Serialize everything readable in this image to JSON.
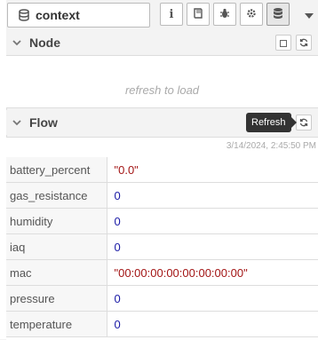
{
  "sidebar_tab": {
    "label": "context"
  },
  "toolbar": {
    "buttons": [
      {
        "icon": "info-icon"
      },
      {
        "icon": "book-icon"
      },
      {
        "icon": "bug-icon"
      },
      {
        "icon": "gear-icon"
      },
      {
        "icon": "database-icon",
        "selected": true
      }
    ]
  },
  "node_section": {
    "title": "Node",
    "hint": "refresh to load"
  },
  "flow_section": {
    "title": "Flow",
    "timestamp": "3/14/2024, 2:45:50 PM",
    "tooltip": "Refresh",
    "properties": [
      {
        "key": "battery_percent",
        "value": "\"0.0\"",
        "type": "string"
      },
      {
        "key": "gas_resistance",
        "value": "0",
        "type": "number"
      },
      {
        "key": "humidity",
        "value": "0",
        "type": "number"
      },
      {
        "key": "iaq",
        "value": "0",
        "type": "number"
      },
      {
        "key": "mac",
        "value": "\"00:00:00:00:00:00:00:00\"",
        "type": "string"
      },
      {
        "key": "pressure",
        "value": "0",
        "type": "number"
      },
      {
        "key": "temperature",
        "value": "0",
        "type": "number"
      }
    ]
  },
  "colors": {
    "string_value": "#a31515",
    "number_value": "#1a1aa6",
    "tooltip_bg": "#333333"
  }
}
